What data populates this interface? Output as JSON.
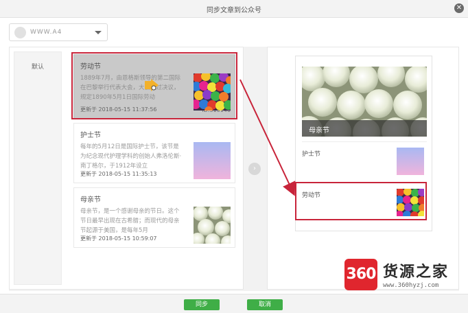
{
  "window": {
    "title": "同步文章到公众号",
    "close_glyph": "✕"
  },
  "account": {
    "name": "WWW.A4"
  },
  "categories": [
    {
      "label": "默认"
    }
  ],
  "articles": [
    {
      "title": "劳动节",
      "excerpt": "1889年7月，由恩格斯领导的第二国际在巴黎举行代表大会，大会通过决议，规定1890年5月1日国际劳动",
      "updated_label": "更新于",
      "updated": "2018-05-15 11:37:56",
      "id": "ID:313146",
      "selected": true,
      "thumb": "balloons"
    },
    {
      "title": "护士节",
      "excerpt": "每年的5月12日是国际护士节，该节是为纪念现代护理学科的创始人弗洛伦斯·南丁格尔，于1912年设立",
      "updated_label": "更新于",
      "updated": "2018-05-15 11:35:13",
      "id": "ID:313137",
      "selected": false,
      "thumb": "gradient"
    },
    {
      "title": "母亲节",
      "excerpt": "母亲节，是一个感谢母亲的节日。这个节日最早出现在古希腊；而现代的母亲节起源于美国，是每年5月",
      "updated_label": "更新于",
      "updated": "2018-05-15 10:59:07",
      "id": "ID:313065",
      "selected": false,
      "thumb": "roses"
    }
  ],
  "preview": {
    "cover_title": "母亲节",
    "items": [
      {
        "title": "护士节",
        "thumb": "gradient"
      },
      {
        "title": "劳动节",
        "thumb": "balloons"
      }
    ]
  },
  "buttons": {
    "sync": "同步",
    "cancel": "取消"
  },
  "watermark": {
    "badge": "360",
    "text": "货源之家",
    "url": "www.360hyzj.com"
  },
  "colors": {
    "accent_green": "#3fae47",
    "highlight_red": "#c8243a",
    "watermark_red": "#e0262e"
  }
}
